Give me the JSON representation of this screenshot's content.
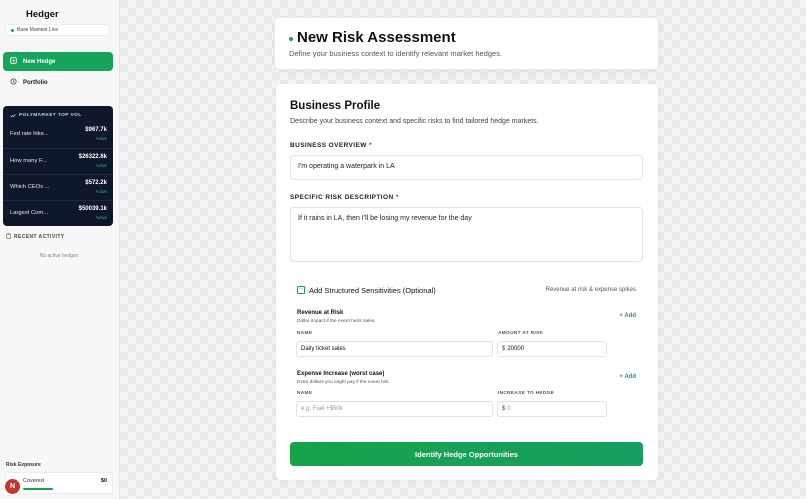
{
  "app": {
    "name": "Hedger",
    "network": "Base Mainnet Live"
  },
  "nav": {
    "new_hedge": "New Hedge",
    "portfolio": "Portfolio"
  },
  "polymarket": {
    "heading": "POLYMARKET TOP VOL",
    "rows": [
      {
        "question": "Fed rate hike...",
        "volume": "$967.7k",
        "status": "Active"
      },
      {
        "question": "How many F...",
        "volume": "$26322.6k",
        "status": "Active"
      },
      {
        "question": "Which CEOs ...",
        "volume": "$572.2k",
        "status": "Active"
      },
      {
        "question": "Largest Com...",
        "volume": "$50039.1k",
        "status": "Active"
      }
    ]
  },
  "recent": {
    "heading": "RECENT ACTIVITY",
    "empty": "No active hedges"
  },
  "risk": {
    "label": "Risk Exposure",
    "covered_label": "Covered",
    "value": "$0",
    "coverage_fraction": 0.3
  },
  "user": {
    "initial": "N"
  },
  "header": {
    "title": "New Risk Assessment",
    "subtitle": "Define your business context to identify relevant market hedges."
  },
  "profile": {
    "title": "Business Profile",
    "subtitle": "Describe your business context and specific risks to find tailored hedge markets.",
    "overview_label": "BUSINESS OVERVIEW",
    "overview_value": "I'm operating a waterpark in LA",
    "risk_label": "SPECIFIC RISK DESCRIPTION",
    "risk_value": "If it rains in LA, then I'll be losing my revenue for the day",
    "required_mark": "*"
  },
  "sensitivities": {
    "toggle_label": "Add Structured Sensitivities (Optional)",
    "toggle_mark": "−",
    "right_hint": "Revenue at risk & expense spikes",
    "revenue": {
      "title": "Revenue at Risk",
      "desc": "Dollar impact if the event hurts sales.",
      "add": "+ Add",
      "name_label": "NAME",
      "amount_label": "AMOUNT AT RISK",
      "name_value": "Daily ticket sales",
      "currency": "$",
      "amount_value": "20000"
    },
    "expense": {
      "title": "Expense Increase (worst case)",
      "desc": "Extra dollars you might pay if the event hits.",
      "add": "+ Add",
      "name_label": "NAME",
      "amount_label": "INCREASE TO HEDGE",
      "name_placeholder": "e.g. Fuel +$50k",
      "currency": "$",
      "amount_placeholder": "0"
    }
  },
  "cta": {
    "label": "Identify Hedge Opportunities"
  },
  "colors": {
    "accent": "#16a34a",
    "dark_panel": "#0f172a",
    "required": "#dc2626"
  }
}
